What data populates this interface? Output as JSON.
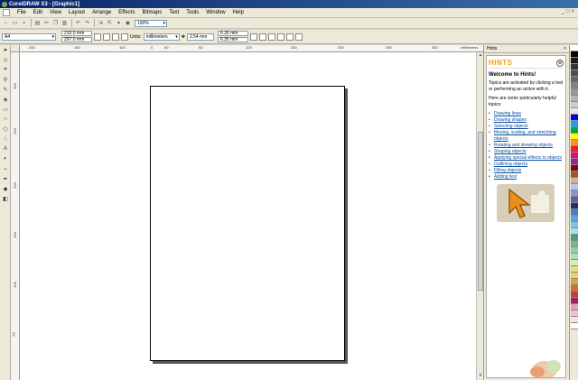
{
  "window": {
    "title": "CorelDRAW X3 - [Graphic1]",
    "controls": [
      "_",
      "□",
      "×"
    ]
  },
  "menu": {
    "items": [
      "File",
      "Edit",
      "View",
      "Layout",
      "Arrange",
      "Effects",
      "Bitmaps",
      "Text",
      "Tools",
      "Window",
      "Help"
    ]
  },
  "toolbar": {
    "zoom": "100%"
  },
  "propbar": {
    "paper_size": "A4",
    "width": "210.0 mm",
    "height": "297.0 mm",
    "units_label": "Units:",
    "units_value": "millimeters",
    "nudge": "2.54 mm",
    "dup_x": "6.35 mm",
    "dup_y": "6.35 mm"
  },
  "ruler_h": {
    "labels": [
      "200",
      "150",
      "100",
      "50",
      "0",
      "50",
      "100",
      "150",
      "200",
      "250",
      "300"
    ],
    "unit": "millimeters"
  },
  "ruler_v": {
    "labels": [
      "300",
      "250",
      "200",
      "150",
      "100",
      "50"
    ]
  },
  "hints": {
    "panel_title": "Hints",
    "logo": "HINTS",
    "welcome": "Welcome to Hints!",
    "intro": "Topics are activated by clicking a tool or performing an action with it.",
    "intro2": "Here are some particularly helpful topics:",
    "links": [
      "Drawing lines",
      "Drawing shapes",
      "Selecting objects",
      "Moving, scaling, and stretching objects",
      "Rotating and skewing objects",
      "Shaping objects",
      "Applying special effects to objects",
      "Outlining objects",
      "Filling objects",
      "Adding text"
    ]
  },
  "palette": {
    "colors": [
      "#ffffff",
      "#000000",
      "#1a1a1a",
      "#333333",
      "#4d4d4d",
      "#666666",
      "#808080",
      "#999999",
      "#b3b3b3",
      "#cccccc",
      "#e6e6e6",
      "#0000ff",
      "#00aeef",
      "#00a651",
      "#ffff00",
      "#f7941d",
      "#ed1c24",
      "#ec008c",
      "#92278f",
      "#8b0000",
      "#a0522d",
      "#d2b48c",
      "#c0c0ff",
      "#9090d0",
      "#6060a0",
      "#203070",
      "#4080c0",
      "#60a0e0",
      "#80c0e0",
      "#a0e0f0",
      "#40a080",
      "#60c090",
      "#90d0a0",
      "#b0e0b0",
      "#d0f0c0",
      "#e0e080",
      "#f0d060",
      "#e0a040",
      "#d07030",
      "#c04040",
      "#a02060",
      "#e0a0c0",
      "#f0c0d0",
      "#ffe0e0",
      "#ffffff"
    ]
  }
}
